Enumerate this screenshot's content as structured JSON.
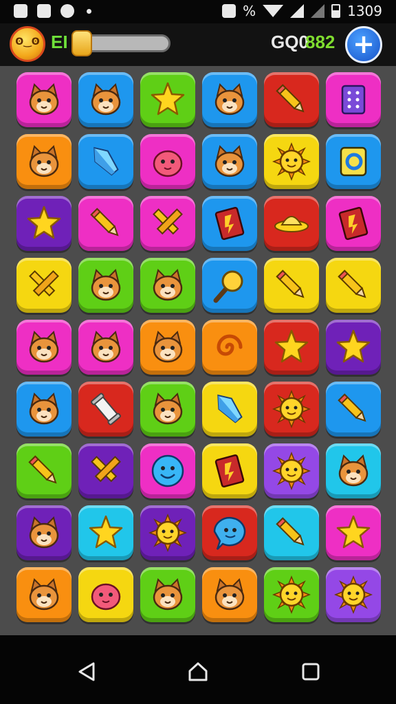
{
  "status_bar": {
    "time": "1309",
    "battery_text": "%",
    "left_icons": [
      "image-icon",
      "camera-icon",
      "infinity-icon",
      "dot-icon"
    ],
    "right_icons": [
      "camera-off-icon",
      "wifi-icon",
      "signal-icon",
      "battery-icon"
    ]
  },
  "hud": {
    "player_name": "EI",
    "level_progress": 0.12,
    "coin_label": "GQ0",
    "coin_value": "882",
    "add_label": "+"
  },
  "colors": {
    "magenta": "#ee2fc4",
    "blue": "#1e97ee",
    "green": "#5fcf16",
    "red": "#d8281e",
    "purple": "#9448e6",
    "orange": "#f98f10",
    "yellow": "#f5d711",
    "violet": "#6f21b8",
    "cyan": "#21c6ea"
  },
  "board": {
    "rows": 9,
    "cols": 6,
    "tiles": [
      [
        "magenta",
        "cat-face-icon",
        "blue",
        "cat-face-icon",
        "green",
        "star-icon",
        "blue",
        "cat-face-icon",
        "red",
        "pencil-icon",
        "magenta",
        "dice-icon"
      ],
      [
        "orange",
        "cat-face-icon",
        "blue",
        "crystal-icon",
        "magenta",
        "blob-face-icon",
        "blue",
        "cat-face-icon",
        "yellow",
        "sun-face-icon",
        "blue",
        "ring-icon"
      ],
      [
        "violet",
        "star-icon",
        "magenta",
        "pencil-icon",
        "magenta",
        "crossed-pencils-icon",
        "blue",
        "book-icon",
        "red",
        "hat-icon",
        "magenta",
        "book-icon"
      ],
      [
        "yellow",
        "crossed-pencils-icon",
        "green",
        "cat-face-icon",
        "green",
        "cat-face-icon",
        "blue",
        "magnifier-icon",
        "yellow",
        "pencil-icon",
        "yellow",
        "pencil-icon"
      ],
      [
        "magenta",
        "cat-face-icon",
        "magenta",
        "cat-face-icon",
        "orange",
        "cat-face-icon",
        "orange",
        "swirl-icon",
        "red",
        "star-icon",
        "violet",
        "star-icon"
      ],
      [
        "blue",
        "cat-face-icon",
        "red",
        "scroll-icon",
        "green",
        "cat-face-icon",
        "yellow",
        "crystal-icon",
        "red",
        "sun-face-icon",
        "blue",
        "pencil-icon"
      ],
      [
        "green",
        "pencil-icon",
        "violet",
        "crossed-pencils-icon",
        "magenta",
        "smiley-icon",
        "yellow",
        "book-icon",
        "purple",
        "sun-face-icon",
        "cyan",
        "cat-face-icon"
      ],
      [
        "violet",
        "cat-face-icon",
        "cyan",
        "star-icon",
        "violet",
        "sun-face-icon",
        "red",
        "chat-face-icon",
        "cyan",
        "pencil-icon",
        "magenta",
        "star-icon"
      ],
      [
        "orange",
        "cat-face-icon",
        "yellow",
        "blob-face-icon",
        "green",
        "cat-face-icon",
        "orange",
        "cat-face-icon",
        "green",
        "sun-face-icon",
        "purple",
        "sun-face-icon"
      ]
    ]
  },
  "navbar": {
    "buttons": [
      "back-icon",
      "home-icon",
      "recent-apps-icon"
    ]
  }
}
